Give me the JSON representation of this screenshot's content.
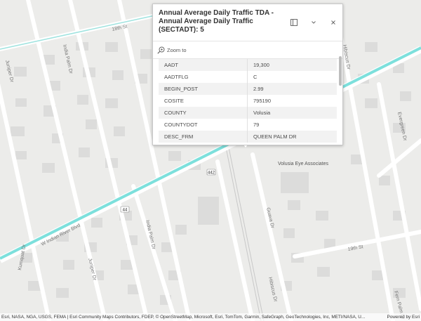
{
  "popup": {
    "title": "Annual Average Daily Traffic TDA - Annual Average Daily Traffic (SECTADT): 5",
    "zoom_label": "Zoom to",
    "fields": [
      {
        "key": "AADT",
        "value": "19,300"
      },
      {
        "key": "AADTFLG",
        "value": "C"
      },
      {
        "key": "BEGIN_POST",
        "value": "2.99"
      },
      {
        "key": "COSITE",
        "value": "795190"
      },
      {
        "key": "COUNTY",
        "value": "Volusia"
      },
      {
        "key": "COUNTYDOT",
        "value": "79"
      },
      {
        "key": "DESC_FRM",
        "value": "QUEEN PALM DR"
      }
    ]
  },
  "map": {
    "labels": {
      "st18": "18th St",
      "juniper_nw": "Juniper Dr",
      "indiapalm_top": "India Palm Dr",
      "hibiscus_top": "Hibiscus Dr",
      "evergreen": "Evergreen Dr",
      "route442": "442",
      "indianriver": "W Indian River Blvd",
      "route44": "44",
      "indiapalm_bottom": "India Palm Dr",
      "juniper_bottom": "Juniper Dr",
      "kumquat": "Kumquat Dr",
      "guava": "Guava Dr",
      "hibiscus_bottom": "Hibiscus Dr",
      "st19": "19th St",
      "fernpalm": "Fern Palm Dr",
      "poi": "Volusia Eye Associates"
    },
    "highlight_color": "#7de0dc"
  },
  "attribution": {
    "text": "Esri, NASA, NGA, USGS, FEMA | Esri Community Maps Contributors, FDEP, © OpenStreetMap, Microsoft, Esri, TomTom, Garmin, SafeGraph, GeoTechnologies, Inc, METI/NASA, U...",
    "powered": "Powered by Esri"
  }
}
